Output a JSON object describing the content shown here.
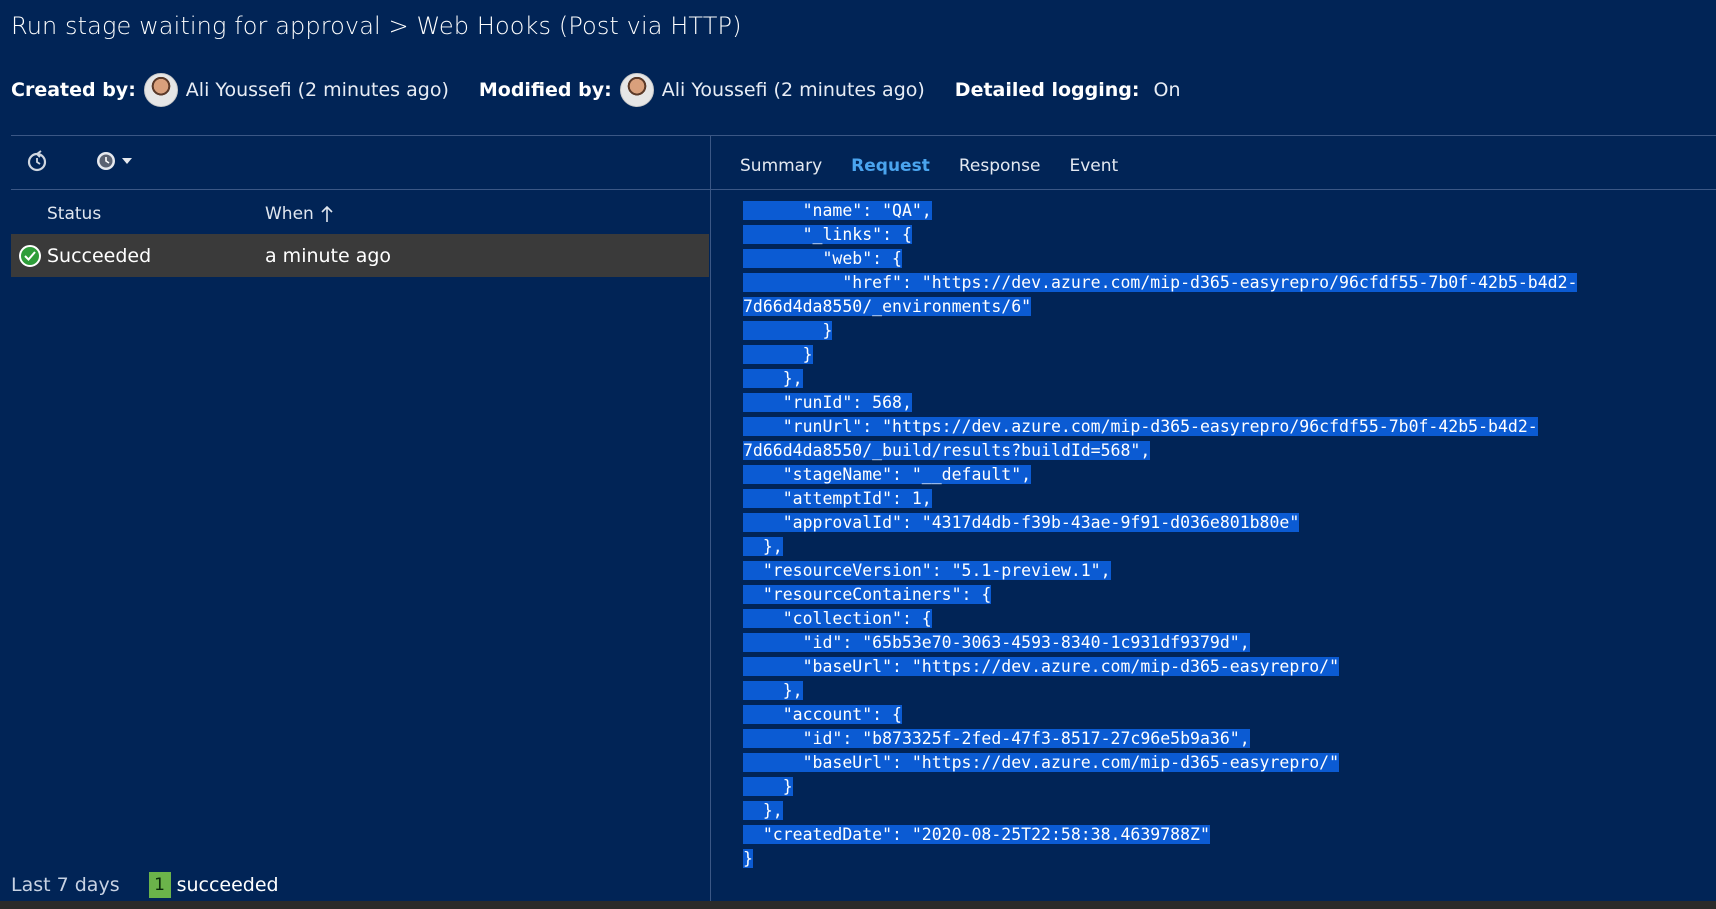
{
  "title": "Run stage waiting for approval > Web Hooks (Post via HTTP)",
  "meta": {
    "created_label": "Created by:",
    "created_by": "Ali Youssefi (2 minutes ago)",
    "modified_label": "Modified by:",
    "modified_by": "Ali Youssefi (2 minutes ago)",
    "logging_label": "Detailed logging:",
    "logging_value": "On"
  },
  "history": {
    "columns": {
      "status": "Status",
      "when": "When"
    },
    "rows": [
      {
        "status": "Succeeded",
        "when": "a minute ago"
      }
    ],
    "footer": {
      "range": "Last 7 days",
      "count": "1",
      "count_label": "succeeded"
    }
  },
  "tabs": [
    {
      "label": "Summary"
    },
    {
      "label": "Request"
    },
    {
      "label": "Response"
    },
    {
      "label": "Event"
    }
  ],
  "request_lines": [
    "      \"name\": \"QA\",",
    "      \"_links\": {",
    "        \"web\": {",
    "          \"href\": \"https://dev.azure.com/mip-d365-easyrepro/96cfdf55-7b0f-42b5-b4d2-",
    "7d66d4da8550/_environments/6\"",
    "        }",
    "      }",
    "    },",
    "    \"runId\": 568,",
    "    \"runUrl\": \"https://dev.azure.com/mip-d365-easyrepro/96cfdf55-7b0f-42b5-b4d2-",
    "7d66d4da8550/_build/results?buildId=568\",",
    "    \"stageName\": \"__default\",",
    "    \"attemptId\": 1,",
    "    \"approvalId\": \"4317d4db-f39b-43ae-9f91-d036e801b80e\"",
    "  },",
    "  \"resourceVersion\": \"5.1-preview.1\",",
    "  \"resourceContainers\": {",
    "    \"collection\": {",
    "      \"id\": \"65b53e70-3063-4593-8340-1c931df9379d\",",
    "      \"baseUrl\": \"https://dev.azure.com/mip-d365-easyrepro/\"",
    "    },",
    "    \"account\": {",
    "      \"id\": \"b873325f-2fed-47f3-8517-27c96e5b9a36\",",
    "      \"baseUrl\": \"https://dev.azure.com/mip-d365-easyrepro/\"",
    "    }",
    "  },",
    "  \"createdDate\": \"2020-08-25T22:58:38.4639788Z\"",
    "}"
  ],
  "colors": {
    "background": "#012456",
    "selection": "#0b5bd3",
    "active_tab": "#4aa4ee",
    "success": "#2e9d3a"
  },
  "icons": {
    "refresh": "refresh-icon",
    "history": "history-icon",
    "success": "check-circle-icon",
    "sort": "arrow-up-icon"
  }
}
